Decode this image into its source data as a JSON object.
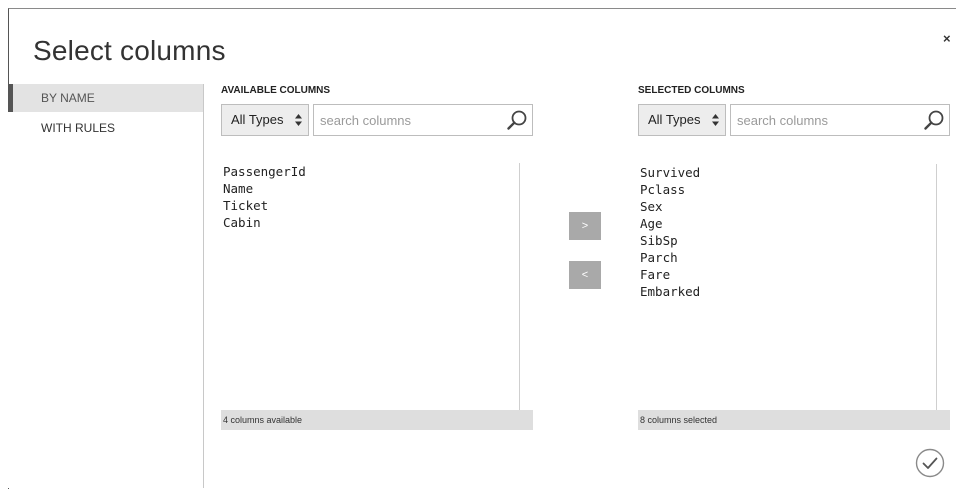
{
  "dialog": {
    "title": "Select columns",
    "close_glyph": "×"
  },
  "sidebar": {
    "items": [
      {
        "label": "BY NAME",
        "active": true
      },
      {
        "label": "WITH RULES",
        "active": false
      }
    ]
  },
  "available": {
    "header": "AVAILABLE COLUMNS",
    "type_filter": "All Types",
    "search_placeholder": "search columns",
    "columns": [
      "PassengerId",
      "Name",
      "Ticket",
      "Cabin"
    ],
    "status": "4 columns available"
  },
  "selected": {
    "header": "SELECTED COLUMNS",
    "type_filter": "All Types",
    "search_placeholder": "search columns",
    "columns": [
      "Survived",
      "Pclass",
      "Sex",
      "Age",
      "SibSp",
      "Parch",
      "Fare",
      "Embarked"
    ],
    "status": "8 columns selected"
  },
  "actions": {
    "add_label": ">",
    "remove_label": "<"
  },
  "icons": {
    "search": "search-icon",
    "confirm": "check-circle-icon",
    "close": "close-icon",
    "sort": "updown-arrows-icon"
  }
}
